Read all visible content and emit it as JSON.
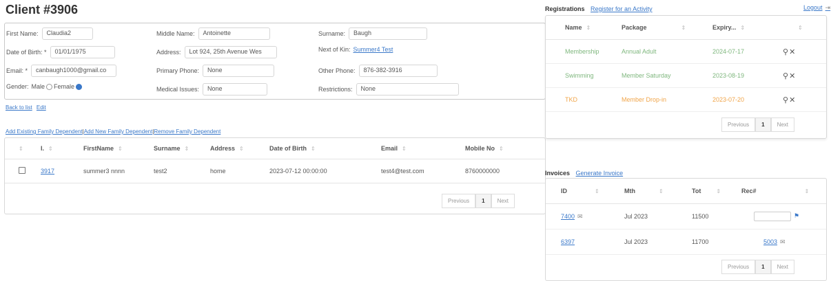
{
  "title": "Client #3906",
  "client": {
    "first_name_label": "First Name:",
    "first_name": "Claudia2",
    "middle_name_label": "Middle Name:",
    "middle_name": "Antoinette",
    "surname_label": "Surname:",
    "surname": "Baugh",
    "dob_label": "Date of Birth: *",
    "dob": "01/01/1975",
    "address_label": "Address:",
    "address": "Lot 924, 25th Avenue Wes",
    "next_of_kin_label": "Next of Kin:",
    "next_of_kin": "Summer4 Test",
    "email_label": "Email: *",
    "email": "canbaugh1000@gmail.co",
    "primary_phone_label": "Primary Phone:",
    "primary_phone": "None",
    "other_phone_label": "Other Phone:",
    "other_phone": "876-382-3916",
    "gender_label": "Gender:",
    "gender_male": "Male",
    "gender_female": "Female",
    "medical_label": "Medical Issues:",
    "medical": "None",
    "restrictions_label": "Restrictions:",
    "restrictions": "None"
  },
  "links": {
    "back": "Back to list",
    "edit": "Edit",
    "add_existing": "Add Existing Family Dependent",
    "add_new": "Add New Family Dependent",
    "remove": "Remove Family Dependent"
  },
  "family_table": {
    "headers": [
      "",
      "I.",
      "FirstName",
      "Surname",
      "Address",
      "Date of Birth",
      "Email",
      "Mobile No"
    ],
    "rows": [
      {
        "id": "3917",
        "first": "summer3 nnnn",
        "surname": "test2",
        "address": "home",
        "dob": "2023-07-12 00:00:00",
        "email": "test4@test.com",
        "mobile": "8760000000"
      }
    ]
  },
  "pager": {
    "prev": "Previous",
    "page": "1",
    "next": "Next"
  },
  "top": {
    "logout": "Logout"
  },
  "registrations": {
    "title": "Registrations",
    "register_link": "Register for an Activity",
    "headers": [
      "Name",
      "Package",
      "Expiry..."
    ],
    "rows": [
      {
        "name": "Membership",
        "package": "Annual Adult",
        "expiry": "2024-07-17"
      },
      {
        "name": "Swimming",
        "package": "Member Saturday",
        "expiry": "2023-08-19"
      },
      {
        "name": "TKD",
        "package": "Member Drop-in",
        "expiry": "2023-07-20"
      }
    ]
  },
  "invoices": {
    "title": "Invoices",
    "generate_link": "Generate Invoice",
    "headers": [
      "ID",
      "Mth",
      "Tot",
      "Rec#"
    ],
    "rows": [
      {
        "id": "7400",
        "mth": "Jul 2023",
        "tot": "11500",
        "rec": ""
      },
      {
        "id": "6397",
        "mth": "Jul 2023",
        "tot": "11700",
        "rec": "5003"
      }
    ]
  },
  "colors": {
    "green": "#7fb77e",
    "orange": "#f0a54a",
    "link": "#3a78c9"
  }
}
